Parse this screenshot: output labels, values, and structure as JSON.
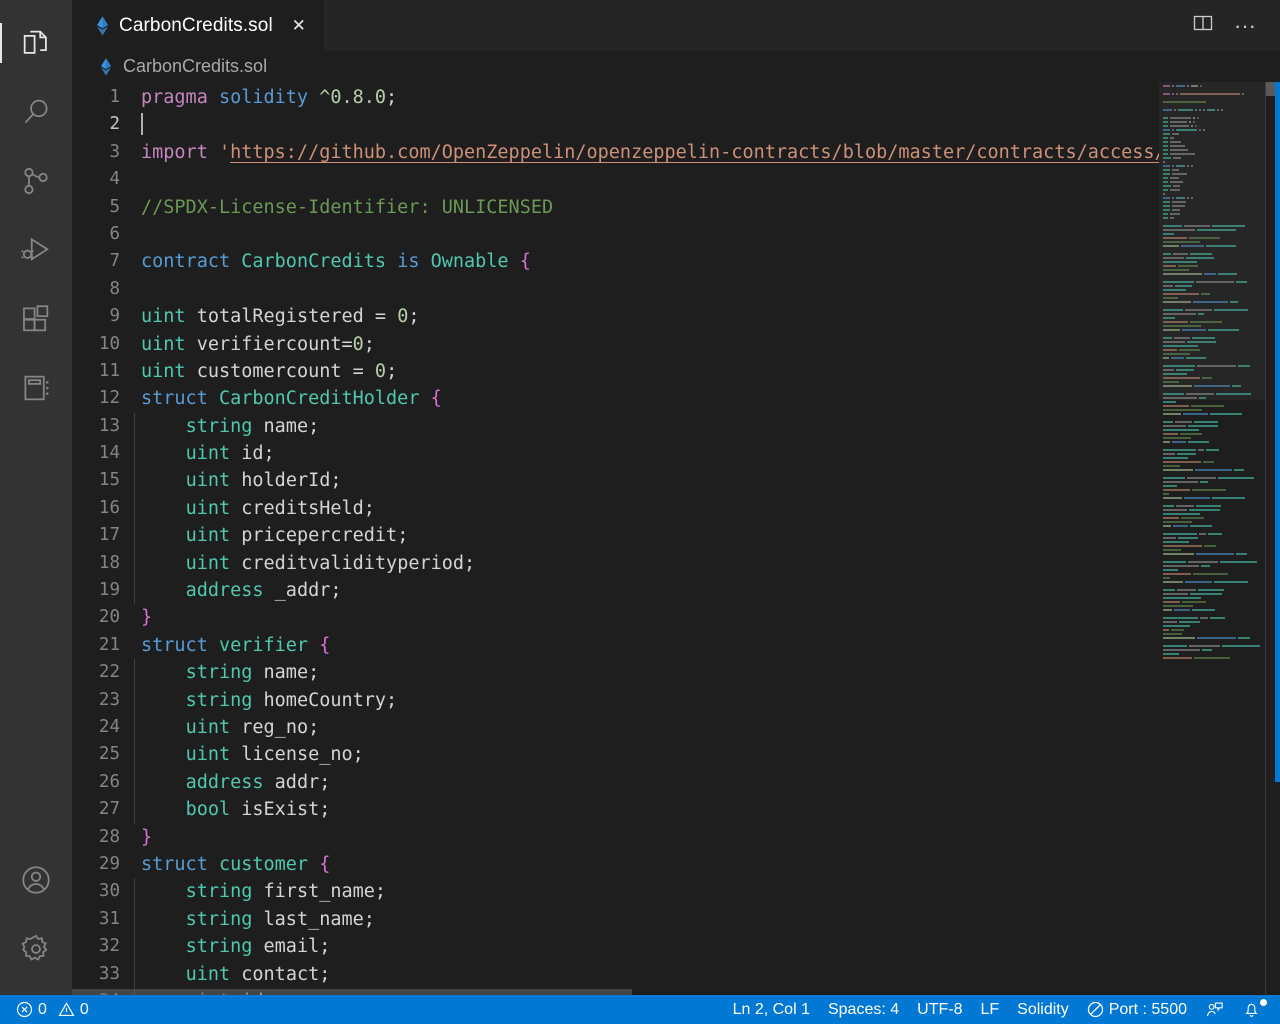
{
  "activity_bar": {
    "top_items": [
      {
        "name": "explorer",
        "icon": "files-icon",
        "active": true
      },
      {
        "name": "search",
        "icon": "search-icon",
        "active": false
      },
      {
        "name": "source-control",
        "icon": "source-control-icon",
        "active": false
      },
      {
        "name": "run-and-debug",
        "icon": "run-debug-icon",
        "active": false
      },
      {
        "name": "extensions",
        "icon": "extensions-icon",
        "active": false
      },
      {
        "name": "remote-explorer",
        "icon": "notebook-icon",
        "active": false
      }
    ],
    "bottom_items": [
      {
        "name": "accounts",
        "icon": "account-icon"
      },
      {
        "name": "manage-settings",
        "icon": "gear-icon"
      }
    ]
  },
  "tab_bar": {
    "tabs": [
      {
        "label": "CarbonCredits.sol",
        "icon": "solidity-icon",
        "active": true,
        "close_glyph": "✕"
      }
    ],
    "actions": [
      {
        "name": "split-editor-right",
        "icon": "split-editor-icon"
      },
      {
        "name": "more-actions",
        "icon": "ellipsis-icon",
        "glyph": "···"
      }
    ]
  },
  "breadcrumb": {
    "icon": "solidity-icon",
    "text": "CarbonCredits.sol"
  },
  "editor": {
    "language": "Solidity",
    "cursor_line": 2,
    "lines": [
      {
        "n": 1,
        "indent": 0,
        "tokens": [
          {
            "t": "kw",
            "s": "pragma"
          },
          {
            "t": "plain",
            "s": " "
          },
          {
            "t": "blue",
            "s": "solidity"
          },
          {
            "t": "plain",
            "s": " "
          },
          {
            "t": "num",
            "s": "^0.8.0"
          },
          {
            "t": "punc",
            "s": ";"
          }
        ]
      },
      {
        "n": 2,
        "indent": 0,
        "cursor": true,
        "tokens": []
      },
      {
        "n": 3,
        "indent": 0,
        "tokens": [
          {
            "t": "kw",
            "s": "import"
          },
          {
            "t": "plain",
            "s": " "
          },
          {
            "t": "str",
            "s": "'"
          },
          {
            "t": "link",
            "s": "https://github.com/OpenZeppelin/openzeppelin-contracts/blob/master/contracts/access/Ownable.sol"
          },
          {
            "t": "str",
            "s": "';"
          }
        ]
      },
      {
        "n": 4,
        "indent": 0,
        "tokens": []
      },
      {
        "n": 5,
        "indent": 0,
        "tokens": [
          {
            "t": "cmt",
            "s": "//SPDX-License-Identifier: UNLICENSED"
          }
        ]
      },
      {
        "n": 6,
        "indent": 0,
        "tokens": []
      },
      {
        "n": 7,
        "indent": 0,
        "tokens": [
          {
            "t": "blue",
            "s": "contract"
          },
          {
            "t": "plain",
            "s": " "
          },
          {
            "t": "type",
            "s": "CarbonCredits"
          },
          {
            "t": "plain",
            "s": " "
          },
          {
            "t": "blue",
            "s": "is"
          },
          {
            "t": "plain",
            "s": " "
          },
          {
            "t": "type",
            "s": "Ownable"
          },
          {
            "t": "plain",
            "s": " "
          },
          {
            "t": "brace",
            "s": "{"
          }
        ]
      },
      {
        "n": 8,
        "indent": 0,
        "tokens": []
      },
      {
        "n": 9,
        "indent": 0,
        "tokens": [
          {
            "t": "vartype",
            "s": "uint"
          },
          {
            "t": "plain",
            "s": " totalRegistered = "
          },
          {
            "t": "num",
            "s": "0"
          },
          {
            "t": "punc",
            "s": ";"
          }
        ]
      },
      {
        "n": 10,
        "indent": 0,
        "tokens": [
          {
            "t": "vartype",
            "s": "uint"
          },
          {
            "t": "plain",
            "s": " verifiercount="
          },
          {
            "t": "num",
            "s": "0"
          },
          {
            "t": "punc",
            "s": ";"
          }
        ]
      },
      {
        "n": 11,
        "indent": 0,
        "tokens": [
          {
            "t": "vartype",
            "s": "uint"
          },
          {
            "t": "plain",
            "s": " customercount = "
          },
          {
            "t": "num",
            "s": "0"
          },
          {
            "t": "punc",
            "s": ";"
          }
        ]
      },
      {
        "n": 12,
        "indent": 0,
        "tokens": [
          {
            "t": "blue",
            "s": "struct"
          },
          {
            "t": "plain",
            "s": " "
          },
          {
            "t": "type",
            "s": "CarbonCreditHolder"
          },
          {
            "t": "plain",
            "s": " "
          },
          {
            "t": "brace",
            "s": "{"
          }
        ]
      },
      {
        "n": 13,
        "indent": 1,
        "tokens": [
          {
            "t": "vartype",
            "s": "string"
          },
          {
            "t": "plain",
            "s": " name;"
          }
        ]
      },
      {
        "n": 14,
        "indent": 1,
        "tokens": [
          {
            "t": "vartype",
            "s": "uint"
          },
          {
            "t": "plain",
            "s": " id;"
          }
        ]
      },
      {
        "n": 15,
        "indent": 1,
        "tokens": [
          {
            "t": "vartype",
            "s": "uint"
          },
          {
            "t": "plain",
            "s": " holderId;"
          }
        ]
      },
      {
        "n": 16,
        "indent": 1,
        "tokens": [
          {
            "t": "vartype",
            "s": "uint"
          },
          {
            "t": "plain",
            "s": " creditsHeld;"
          }
        ]
      },
      {
        "n": 17,
        "indent": 1,
        "tokens": [
          {
            "t": "vartype",
            "s": "uint"
          },
          {
            "t": "plain",
            "s": " pricepercredit;"
          }
        ]
      },
      {
        "n": 18,
        "indent": 1,
        "tokens": [
          {
            "t": "vartype",
            "s": "uint"
          },
          {
            "t": "plain",
            "s": " creditvalidityperiod;"
          }
        ]
      },
      {
        "n": 19,
        "indent": 1,
        "tokens": [
          {
            "t": "vartype",
            "s": "address"
          },
          {
            "t": "plain",
            "s": " _addr;"
          }
        ]
      },
      {
        "n": 20,
        "indent": 0,
        "tokens": [
          {
            "t": "brace",
            "s": "}"
          }
        ]
      },
      {
        "n": 21,
        "indent": 0,
        "tokens": [
          {
            "t": "blue",
            "s": "struct"
          },
          {
            "t": "plain",
            "s": " "
          },
          {
            "t": "type",
            "s": "verifier"
          },
          {
            "t": "plain",
            "s": " "
          },
          {
            "t": "brace",
            "s": "{"
          }
        ]
      },
      {
        "n": 22,
        "indent": 1,
        "tokens": [
          {
            "t": "vartype",
            "s": "string"
          },
          {
            "t": "plain",
            "s": " name;"
          }
        ]
      },
      {
        "n": 23,
        "indent": 1,
        "tokens": [
          {
            "t": "vartype",
            "s": "string"
          },
          {
            "t": "plain",
            "s": " homeCountry;"
          }
        ]
      },
      {
        "n": 24,
        "indent": 1,
        "tokens": [
          {
            "t": "vartype",
            "s": "uint"
          },
          {
            "t": "plain",
            "s": " reg_no;"
          }
        ]
      },
      {
        "n": 25,
        "indent": 1,
        "tokens": [
          {
            "t": "vartype",
            "s": "uint"
          },
          {
            "t": "plain",
            "s": " license_no;"
          }
        ]
      },
      {
        "n": 26,
        "indent": 1,
        "tokens": [
          {
            "t": "vartype",
            "s": "address"
          },
          {
            "t": "plain",
            "s": " addr;"
          }
        ]
      },
      {
        "n": 27,
        "indent": 1,
        "tokens": [
          {
            "t": "vartype",
            "s": "bool"
          },
          {
            "t": "plain",
            "s": " isExist;"
          }
        ]
      },
      {
        "n": 28,
        "indent": 0,
        "tokens": [
          {
            "t": "brace",
            "s": "}"
          }
        ]
      },
      {
        "n": 29,
        "indent": 0,
        "tokens": [
          {
            "t": "blue",
            "s": "struct"
          },
          {
            "t": "plain",
            "s": " "
          },
          {
            "t": "type",
            "s": "customer"
          },
          {
            "t": "plain",
            "s": " "
          },
          {
            "t": "brace",
            "s": "{"
          }
        ]
      },
      {
        "n": 30,
        "indent": 1,
        "tokens": [
          {
            "t": "vartype",
            "s": "string"
          },
          {
            "t": "plain",
            "s": " first_name;"
          }
        ]
      },
      {
        "n": 31,
        "indent": 1,
        "tokens": [
          {
            "t": "vartype",
            "s": "string"
          },
          {
            "t": "plain",
            "s": " last_name;"
          }
        ]
      },
      {
        "n": 32,
        "indent": 1,
        "tokens": [
          {
            "t": "vartype",
            "s": "string"
          },
          {
            "t": "plain",
            "s": " email;"
          }
        ]
      },
      {
        "n": 33,
        "indent": 1,
        "tokens": [
          {
            "t": "vartype",
            "s": "uint"
          },
          {
            "t": "plain",
            "s": " contact;"
          }
        ]
      },
      {
        "n": 34,
        "indent": 1,
        "tokens": [
          {
            "t": "vartype",
            "s": "uint"
          },
          {
            "t": "plain",
            "s": " id;"
          }
        ]
      }
    ]
  },
  "status_bar": {
    "left": [
      {
        "name": "problems",
        "error_icon": "error-circle-icon",
        "error_count": "0",
        "warning_icon": "warning-triangle-icon",
        "warning_count": "0"
      }
    ],
    "right": [
      {
        "name": "cursor-position",
        "label": "Ln 2, Col 1"
      },
      {
        "name": "indentation",
        "label": "Spaces: 4"
      },
      {
        "name": "encoding",
        "label": "UTF-8"
      },
      {
        "name": "end-of-line",
        "label": "LF"
      },
      {
        "name": "language-mode",
        "label": "Solidity"
      },
      {
        "name": "live-server-port",
        "label": "Port : 5500",
        "icon": "no-entry-icon"
      },
      {
        "name": "feedback",
        "icon": "feedback-icon"
      },
      {
        "name": "notifications",
        "icon": "bell-icon",
        "has_dot": true
      }
    ]
  },
  "colors": {
    "accent": "#0078d4",
    "editor_bg": "#1e1e1e",
    "activity_bar_bg": "#333333",
    "tab_bar_bg": "#252526",
    "solidity_icon": "#3c9ae8"
  }
}
